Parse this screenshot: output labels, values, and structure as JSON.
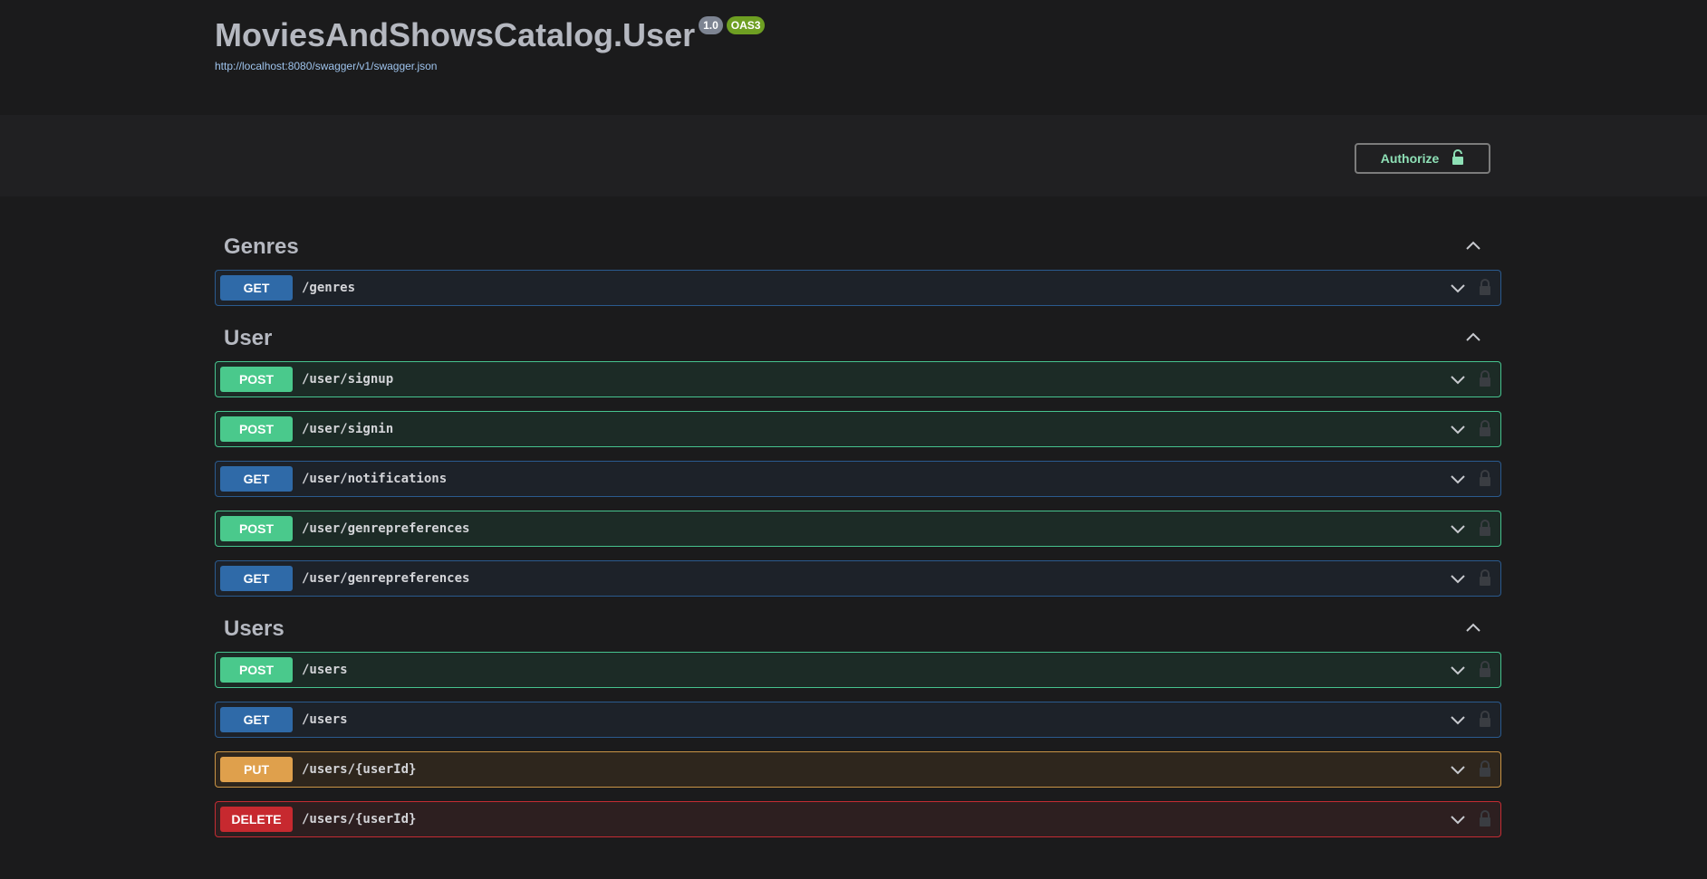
{
  "info": {
    "title": "MoviesAndShowsCatalog.User",
    "version": "1.0",
    "oas": "OAS3",
    "spec_url": "http://localhost:8080/swagger/v1/swagger.json"
  },
  "authorize": {
    "label": "Authorize"
  },
  "colors": {
    "get": "#2f6aa8",
    "post": "#4ac98c",
    "put": "#dfa04c",
    "delete": "#c7292f"
  },
  "tags": [
    {
      "name": "Genres",
      "operations": [
        {
          "method": "GET",
          "path": "/genres"
        }
      ]
    },
    {
      "name": "User",
      "operations": [
        {
          "method": "POST",
          "path": "/user/signup"
        },
        {
          "method": "POST",
          "path": "/user/signin"
        },
        {
          "method": "GET",
          "path": "/user/notifications"
        },
        {
          "method": "POST",
          "path": "/user/genrepreferences"
        },
        {
          "method": "GET",
          "path": "/user/genrepreferences"
        }
      ]
    },
    {
      "name": "Users",
      "operations": [
        {
          "method": "POST",
          "path": "/users"
        },
        {
          "method": "GET",
          "path": "/users"
        },
        {
          "method": "PUT",
          "path": "/users/{userId}"
        },
        {
          "method": "DELETE",
          "path": "/users/{userId}"
        }
      ]
    }
  ]
}
